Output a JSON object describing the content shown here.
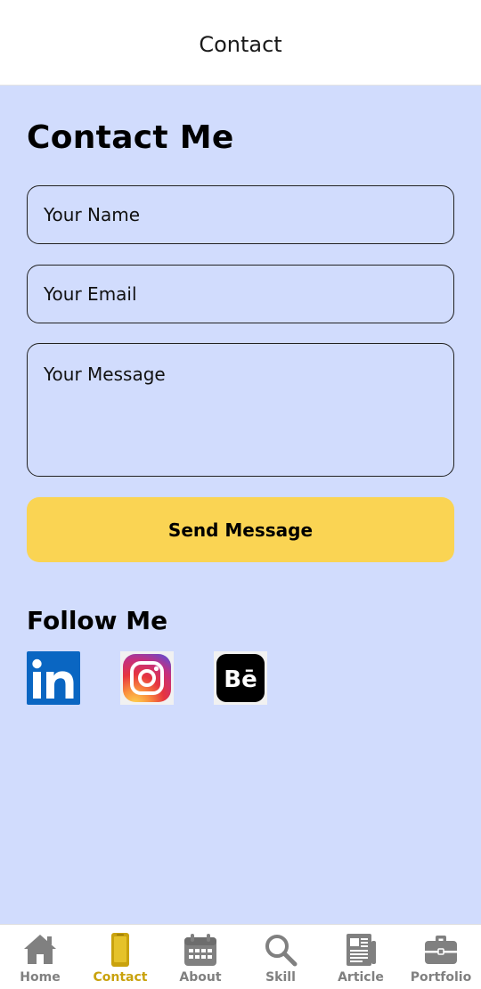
{
  "header": {
    "title": "Contact"
  },
  "main": {
    "heading": "Contact Me",
    "form": {
      "name_placeholder": "Your Name",
      "email_placeholder": "Your Email",
      "message_placeholder": "Your Message",
      "submit_label": "Send Message"
    },
    "follow": {
      "heading": "Follow Me",
      "links": [
        {
          "icon": "linkedin-icon",
          "color": "#0a66c2",
          "glyph": "in"
        },
        {
          "icon": "instagram-icon",
          "color": "#c13584"
        },
        {
          "icon": "behance-icon",
          "color": "#000000",
          "glyph": "Bē"
        }
      ]
    }
  },
  "bottom_nav": {
    "active": "Contact",
    "accent_color": "#c9a20d",
    "items": [
      {
        "label": "Home",
        "icon": "home-icon"
      },
      {
        "label": "Contact",
        "icon": "phone-icon"
      },
      {
        "label": "About",
        "icon": "calendar-icon"
      },
      {
        "label": "Skill",
        "icon": "search-icon"
      },
      {
        "label": "Article",
        "icon": "newspaper-icon"
      },
      {
        "label": "Portfolio",
        "icon": "briefcase-icon"
      }
    ]
  },
  "colors": {
    "background": "#d1dcfd",
    "button": "#fad453"
  }
}
